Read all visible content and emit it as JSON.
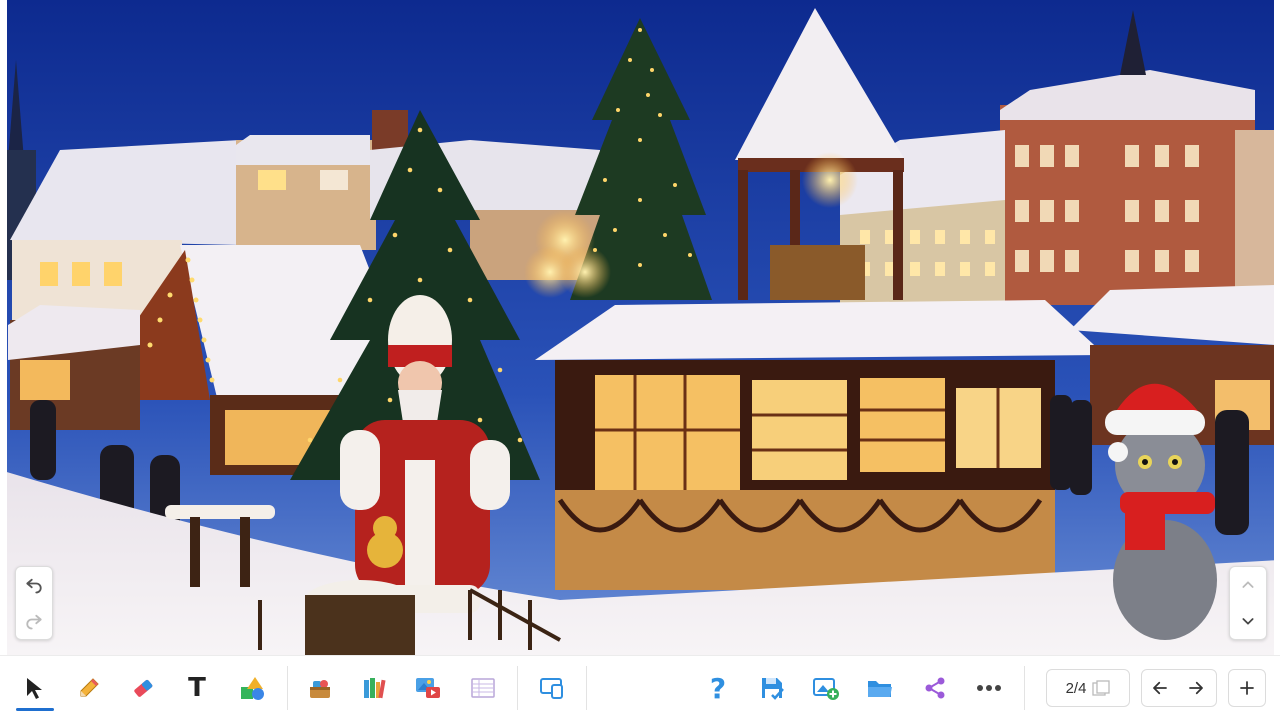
{
  "canvas": {
    "slide_image": "christmas-market-night-scene",
    "colors": {
      "sky_top": "#0f2a8c",
      "sky_bottom": "#4a73c9",
      "snow": "#f3f1f4",
      "light": "#ffd87a"
    }
  },
  "side_controls": {
    "undo_icon": "undo-icon",
    "redo_icon": "redo-icon",
    "page_up_icon": "chevron-up-icon",
    "page_down_icon": "chevron-down-icon"
  },
  "toolbar": {
    "tools": [
      {
        "id": "select",
        "icon": "cursor-arrow-icon",
        "active": true
      },
      {
        "id": "pen",
        "icon": "pencil-icon"
      },
      {
        "id": "eraser",
        "icon": "eraser-icon"
      },
      {
        "id": "text",
        "icon": "text-icon",
        "glyph": "T"
      },
      {
        "id": "shapes",
        "icon": "shapes-icon"
      },
      {
        "id": "add-ons",
        "icon": "toolbox-icon"
      },
      {
        "id": "library",
        "icon": "books-icon"
      },
      {
        "id": "media",
        "icon": "image-video-icon"
      },
      {
        "id": "table",
        "icon": "table-icon"
      },
      {
        "id": "screen",
        "icon": "screen-mirror-icon"
      }
    ],
    "actions": [
      {
        "id": "help",
        "icon": "question-icon",
        "glyph": "?"
      },
      {
        "id": "save",
        "icon": "save-icon"
      },
      {
        "id": "add-page",
        "icon": "add-image-icon"
      },
      {
        "id": "open",
        "icon": "folder-icon"
      },
      {
        "id": "share",
        "icon": "share-icon"
      },
      {
        "id": "more",
        "icon": "more-dots-icon"
      }
    ],
    "pager": {
      "current_label": "2/4",
      "icon": "pages-icon"
    },
    "nav": {
      "prev_icon": "arrow-left-icon",
      "next_icon": "arrow-right-icon",
      "add_icon": "plus-icon"
    },
    "accent": "#1f6fcf"
  }
}
